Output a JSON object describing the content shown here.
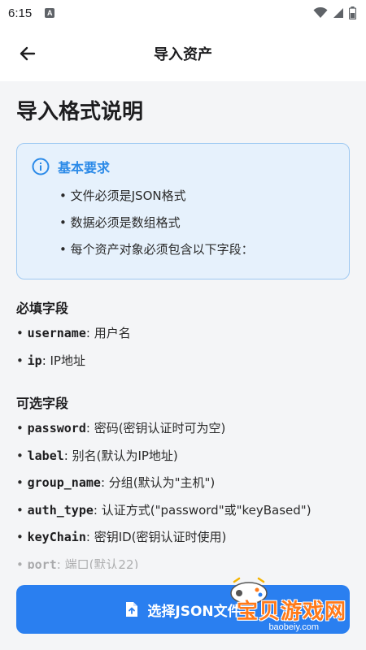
{
  "status_bar": {
    "time": "6:15",
    "notification_letter": "A"
  },
  "app_bar": {
    "title": "导入资产"
  },
  "page": {
    "title": "导入格式说明"
  },
  "info_box": {
    "title": "基本要求",
    "items": [
      "文件必须是JSON格式",
      "数据必须是数组格式",
      "每个资产对象必须包含以下字段："
    ]
  },
  "required_section": {
    "title": "必填字段",
    "fields": [
      {
        "key": "username",
        "desc": ": 用户名"
      },
      {
        "key": "ip",
        "desc": ": IP地址"
      }
    ]
  },
  "optional_section": {
    "title": "可选字段",
    "fields": [
      {
        "key": "password",
        "desc": ": 密码(密钥认证时可为空)"
      },
      {
        "key": "label",
        "desc": ": 别名(默认为IP地址)"
      },
      {
        "key": "group_name",
        "desc": ": 分组(默认为\"主机\")"
      },
      {
        "key": "auth_type",
        "desc": ": 认证方式(\"password\"或\"keyBased\")"
      },
      {
        "key": "keyChain",
        "desc": ": 密钥ID(密钥认证时使用)"
      },
      {
        "key": "port",
        "desc": ": 端口(默认22)"
      }
    ]
  },
  "bottom": {
    "select_button_label": "选择JSON文件"
  },
  "watermark": {
    "text": "宝贝游戏网",
    "url": "baobeiy.com"
  },
  "colors": {
    "accent": "#2a7ff0",
    "info_bg": "#e6f1fc",
    "info_border": "#9ec9f2",
    "info_title": "#2b8ae8",
    "page_bg": "#f4f5f7"
  }
}
